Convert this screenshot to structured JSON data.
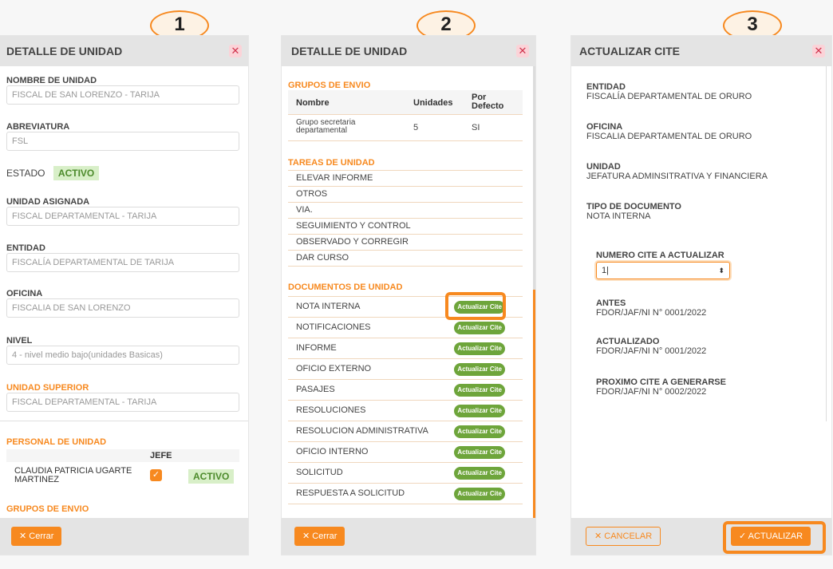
{
  "steps": [
    "1",
    "2",
    "3"
  ],
  "panel1": {
    "title": "DETALLE DE UNIDAD",
    "fields": [
      {
        "label": "NOMBRE DE UNIDAD",
        "value": "FISCAL DE SAN LORENZO - TARIJA"
      },
      {
        "label": "ABREVIATURA",
        "value": "FSL"
      },
      {
        "label": "UNIDAD ASIGNADA",
        "value": "FISCAL DEPARTAMENTAL - TARIJA"
      },
      {
        "label": "ENTIDAD",
        "value": "FISCALÍA DEPARTAMENTAL DE TARIJA"
      },
      {
        "label": "OFICINA",
        "value": "FISCALIA DE SAN LORENZO"
      },
      {
        "label": "NIVEL",
        "value": "4 - nivel medio bajo(unidades Basicas)"
      },
      {
        "label": "UNIDAD SUPERIOR",
        "value": "FISCAL DEPARTAMENTAL - TARIJA"
      }
    ],
    "estado_label": "ESTADO",
    "estado_value": "ACTIVO",
    "personal_title": "PERSONAL DE UNIDAD",
    "jefe_header": "JEFE",
    "person_name": "CLAUDIA PATRICIA UGARTE MARTINEZ",
    "person_status": "ACTIVO",
    "grupos_title": "GRUPOS DE ENVIO",
    "close_label": "✕ Cerrar"
  },
  "panel2": {
    "title": "DETALLE DE UNIDAD",
    "grupos_title": "GRUPOS DE ENVIO",
    "col_nombre": "Nombre",
    "col_unidades": "Unidades",
    "col_defecto": "Por Defecto",
    "grupo_nombre": "Grupo secretaria departamental",
    "grupo_unidades": "5",
    "grupo_defecto": "SI",
    "tareas_title": "TAREAS DE UNIDAD",
    "tareas": [
      "ELEVAR INFORME",
      "OTROS",
      "VIA.",
      "SEGUIMIENTO Y CONTROL",
      "OBSERVADO Y CORREGIR",
      "DAR CURSO"
    ],
    "docs_title": "DOCUMENTOS DE UNIDAD",
    "docs": [
      "NOTA INTERNA",
      "NOTIFICACIONES",
      "INFORME",
      "OFICIO EXTERNO",
      "PASAJES",
      "RESOLUCIONES",
      "RESOLUCION ADMINISTRATIVA",
      "OFICIO INTERNO",
      "SOLICITUD",
      "RESPUESTA A SOLICITUD"
    ],
    "action_label": "Actualizar Cite",
    "close_label": "✕ Cerrar"
  },
  "panel3": {
    "title": "ACTUALIZAR CITE",
    "info": [
      {
        "label": "ENTIDAD",
        "value": "FISCALÍA DEPARTAMENTAL DE ORURO"
      },
      {
        "label": "OFICINA",
        "value": "FISCALIA DEPARTAMENTAL DE ORURO"
      },
      {
        "label": "UNIDAD",
        "value": "JEFATURA ADMINSITRATIVA Y FINANCIERA"
      },
      {
        "label": "TIPO DE DOCUMENTO",
        "value": "NOTA INTERNA"
      }
    ],
    "numero_label": "NUMERO CITE A ACTUALIZAR",
    "numero_value": "1",
    "results": [
      {
        "label": "ANTES",
        "value": "FDOR/JAF/NI N° 0001/2022"
      },
      {
        "label": "ACTUALIZADO",
        "value": "FDOR/JAF/NI N° 0001/2022"
      },
      {
        "label": "PROXIMO CITE A GENERARSE",
        "value": "FDOR/JAF/NI N° 0002/2022"
      }
    ],
    "cancel_label": "✕ CANCELAR",
    "update_label": "✓ ACTUALIZAR"
  },
  "colors": {
    "accent": "#f7891f",
    "green": "#6ea53b",
    "header": "#e4e4e4"
  }
}
